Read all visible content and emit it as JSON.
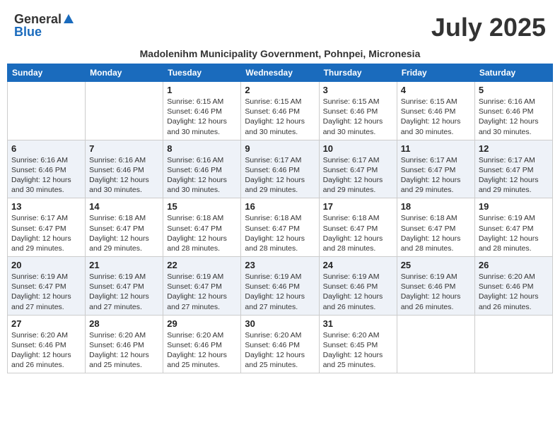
{
  "logo": {
    "general": "General",
    "blue": "Blue"
  },
  "header": {
    "month_title": "July 2025",
    "subtitle": "Madolenihm Municipality Government, Pohnpei, Micronesia"
  },
  "days_of_week": [
    "Sunday",
    "Monday",
    "Tuesday",
    "Wednesday",
    "Thursday",
    "Friday",
    "Saturday"
  ],
  "weeks": [
    [
      {
        "day": "",
        "info": ""
      },
      {
        "day": "",
        "info": ""
      },
      {
        "day": "1",
        "info": "Sunrise: 6:15 AM\nSunset: 6:46 PM\nDaylight: 12 hours and 30 minutes."
      },
      {
        "day": "2",
        "info": "Sunrise: 6:15 AM\nSunset: 6:46 PM\nDaylight: 12 hours and 30 minutes."
      },
      {
        "day": "3",
        "info": "Sunrise: 6:15 AM\nSunset: 6:46 PM\nDaylight: 12 hours and 30 minutes."
      },
      {
        "day": "4",
        "info": "Sunrise: 6:15 AM\nSunset: 6:46 PM\nDaylight: 12 hours and 30 minutes."
      },
      {
        "day": "5",
        "info": "Sunrise: 6:16 AM\nSunset: 6:46 PM\nDaylight: 12 hours and 30 minutes."
      }
    ],
    [
      {
        "day": "6",
        "info": "Sunrise: 6:16 AM\nSunset: 6:46 PM\nDaylight: 12 hours and 30 minutes."
      },
      {
        "day": "7",
        "info": "Sunrise: 6:16 AM\nSunset: 6:46 PM\nDaylight: 12 hours and 30 minutes."
      },
      {
        "day": "8",
        "info": "Sunrise: 6:16 AM\nSunset: 6:46 PM\nDaylight: 12 hours and 30 minutes."
      },
      {
        "day": "9",
        "info": "Sunrise: 6:17 AM\nSunset: 6:46 PM\nDaylight: 12 hours and 29 minutes."
      },
      {
        "day": "10",
        "info": "Sunrise: 6:17 AM\nSunset: 6:47 PM\nDaylight: 12 hours and 29 minutes."
      },
      {
        "day": "11",
        "info": "Sunrise: 6:17 AM\nSunset: 6:47 PM\nDaylight: 12 hours and 29 minutes."
      },
      {
        "day": "12",
        "info": "Sunrise: 6:17 AM\nSunset: 6:47 PM\nDaylight: 12 hours and 29 minutes."
      }
    ],
    [
      {
        "day": "13",
        "info": "Sunrise: 6:17 AM\nSunset: 6:47 PM\nDaylight: 12 hours and 29 minutes."
      },
      {
        "day": "14",
        "info": "Sunrise: 6:18 AM\nSunset: 6:47 PM\nDaylight: 12 hours and 29 minutes."
      },
      {
        "day": "15",
        "info": "Sunrise: 6:18 AM\nSunset: 6:47 PM\nDaylight: 12 hours and 28 minutes."
      },
      {
        "day": "16",
        "info": "Sunrise: 6:18 AM\nSunset: 6:47 PM\nDaylight: 12 hours and 28 minutes."
      },
      {
        "day": "17",
        "info": "Sunrise: 6:18 AM\nSunset: 6:47 PM\nDaylight: 12 hours and 28 minutes."
      },
      {
        "day": "18",
        "info": "Sunrise: 6:18 AM\nSunset: 6:47 PM\nDaylight: 12 hours and 28 minutes."
      },
      {
        "day": "19",
        "info": "Sunrise: 6:19 AM\nSunset: 6:47 PM\nDaylight: 12 hours and 28 minutes."
      }
    ],
    [
      {
        "day": "20",
        "info": "Sunrise: 6:19 AM\nSunset: 6:47 PM\nDaylight: 12 hours and 27 minutes."
      },
      {
        "day": "21",
        "info": "Sunrise: 6:19 AM\nSunset: 6:47 PM\nDaylight: 12 hours and 27 minutes."
      },
      {
        "day": "22",
        "info": "Sunrise: 6:19 AM\nSunset: 6:47 PM\nDaylight: 12 hours and 27 minutes."
      },
      {
        "day": "23",
        "info": "Sunrise: 6:19 AM\nSunset: 6:46 PM\nDaylight: 12 hours and 27 minutes."
      },
      {
        "day": "24",
        "info": "Sunrise: 6:19 AM\nSunset: 6:46 PM\nDaylight: 12 hours and 26 minutes."
      },
      {
        "day": "25",
        "info": "Sunrise: 6:19 AM\nSunset: 6:46 PM\nDaylight: 12 hours and 26 minutes."
      },
      {
        "day": "26",
        "info": "Sunrise: 6:20 AM\nSunset: 6:46 PM\nDaylight: 12 hours and 26 minutes."
      }
    ],
    [
      {
        "day": "27",
        "info": "Sunrise: 6:20 AM\nSunset: 6:46 PM\nDaylight: 12 hours and 26 minutes."
      },
      {
        "day": "28",
        "info": "Sunrise: 6:20 AM\nSunset: 6:46 PM\nDaylight: 12 hours and 25 minutes."
      },
      {
        "day": "29",
        "info": "Sunrise: 6:20 AM\nSunset: 6:46 PM\nDaylight: 12 hours and 25 minutes."
      },
      {
        "day": "30",
        "info": "Sunrise: 6:20 AM\nSunset: 6:46 PM\nDaylight: 12 hours and 25 minutes."
      },
      {
        "day": "31",
        "info": "Sunrise: 6:20 AM\nSunset: 6:45 PM\nDaylight: 12 hours and 25 minutes."
      },
      {
        "day": "",
        "info": ""
      },
      {
        "day": "",
        "info": ""
      }
    ]
  ]
}
